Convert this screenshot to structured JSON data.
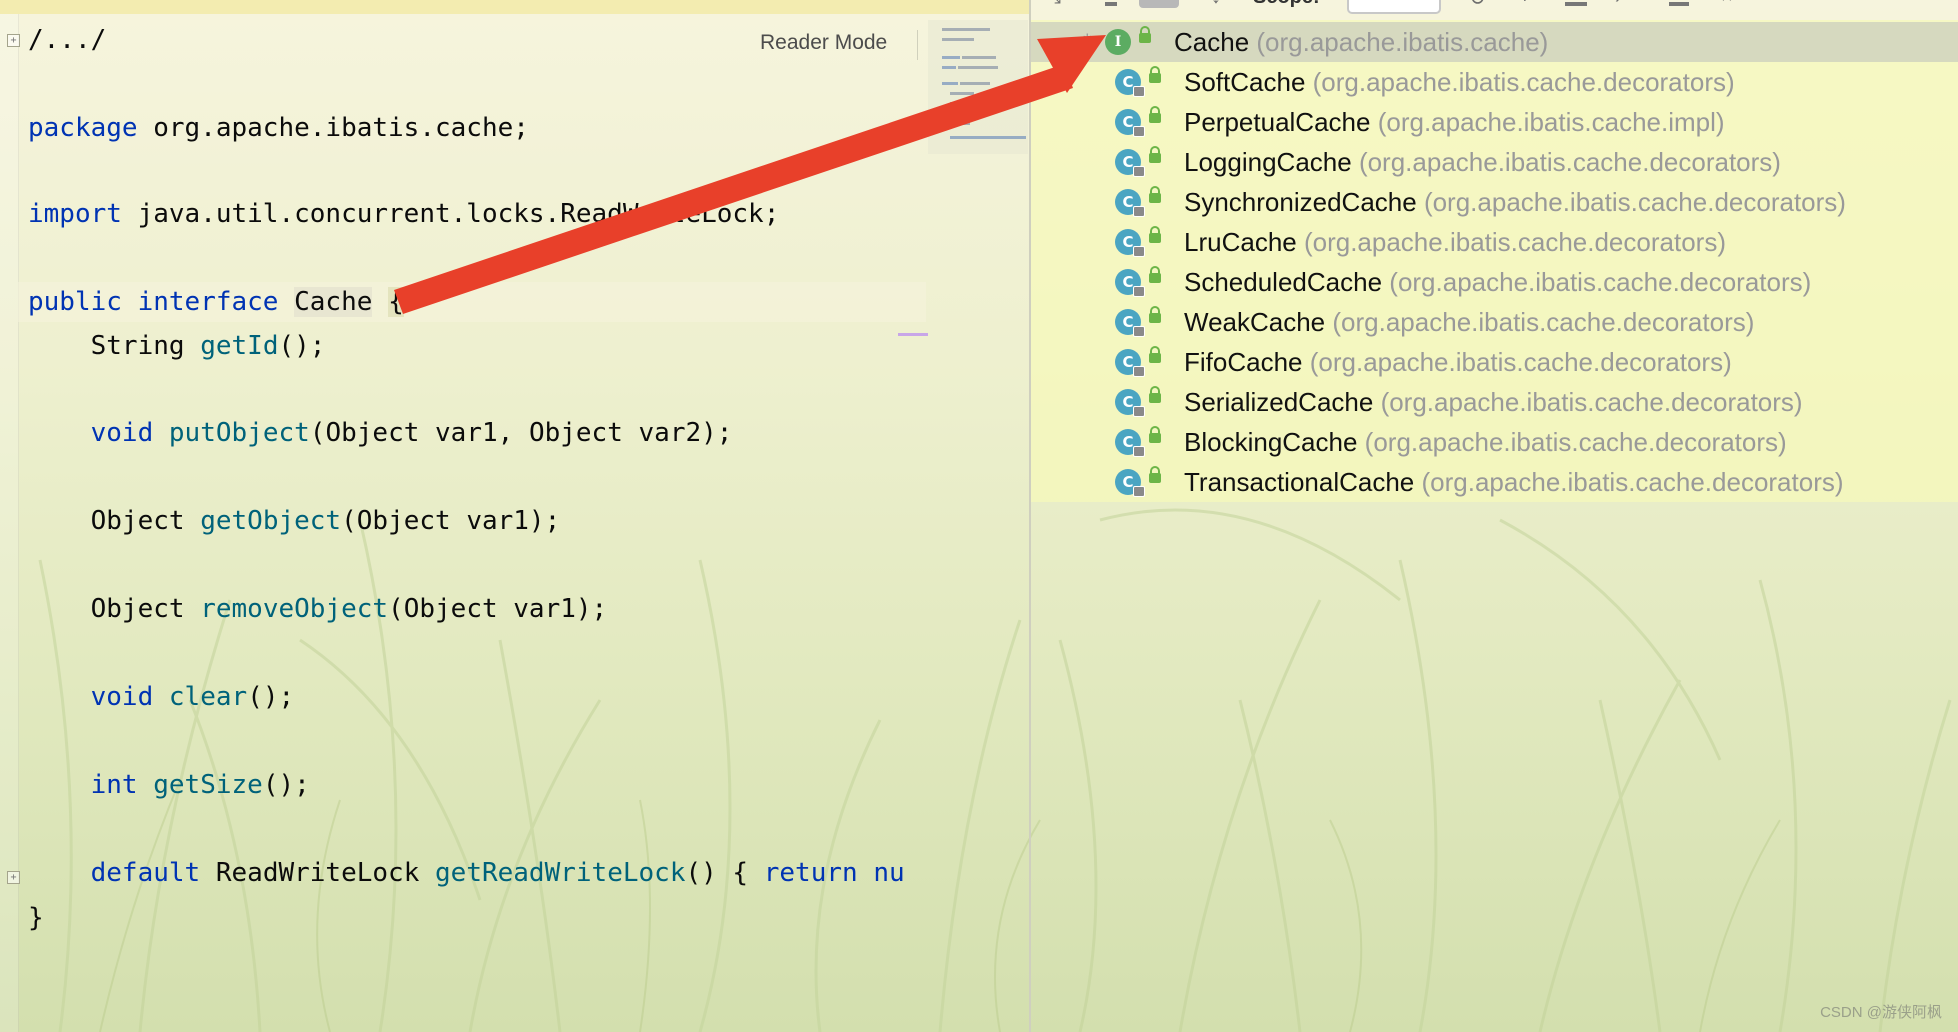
{
  "editor": {
    "reader_mode_label": "Reader Mode",
    "fold_top": "+",
    "fold_bottom": "+",
    "lines": {
      "l1": "/.../",
      "l2": {
        "kw": "package",
        "rest": " org.apache.ibatis.cache;"
      },
      "l3": {
        "kw": "import",
        "rest": " java.util.concurrent.locks.ReadWriteLock;"
      },
      "l4": {
        "kw1": "public",
        "kw2": "interface",
        "name": "Cache",
        "brace": "{"
      },
      "l5": {
        "type": "String",
        "fn": "getId",
        "rest": "();"
      },
      "l6": {
        "kw": "void",
        "fn": "putObject",
        "rest": "(Object var1, Object var2);"
      },
      "l7": {
        "type": "Object",
        "fn": "getObject",
        "rest": "(Object var1);"
      },
      "l8": {
        "type": "Object",
        "fn": "removeObject",
        "rest": "(Object var1);"
      },
      "l9": {
        "kw": "void",
        "fn": "clear",
        "rest": "();"
      },
      "l10": {
        "kw": "int",
        "fn": "getSize",
        "rest": "();"
      },
      "l11": {
        "kw": "default",
        "type": "ReadWriteLock",
        "fn": "getReadWriteLock",
        "rest": "() { ",
        "kw2": "return",
        "tail": " nu"
      },
      "l12": "}"
    }
  },
  "hierarchy": {
    "toolbar": {
      "scope_label": "Scope:"
    },
    "root": {
      "star": "*",
      "icon": "I",
      "name": "Cache",
      "package": "(org.apache.ibatis.cache)"
    },
    "items": [
      {
        "icon": "C",
        "name": "SoftCache",
        "package": "(org.apache.ibatis.cache.decorators)"
      },
      {
        "icon": "C",
        "name": "PerpetualCache",
        "package": "(org.apache.ibatis.cache.impl)"
      },
      {
        "icon": "C",
        "name": "LoggingCache",
        "package": "(org.apache.ibatis.cache.decorators)"
      },
      {
        "icon": "C",
        "name": "SynchronizedCache",
        "package": "(org.apache.ibatis.cache.decorators)"
      },
      {
        "icon": "C",
        "name": "LruCache",
        "package": "(org.apache.ibatis.cache.decorators)"
      },
      {
        "icon": "C",
        "name": "ScheduledCache",
        "package": "(org.apache.ibatis.cache.decorators)"
      },
      {
        "icon": "C",
        "name": "WeakCache",
        "package": "(org.apache.ibatis.cache.decorators)"
      },
      {
        "icon": "C",
        "name": "FifoCache",
        "package": "(org.apache.ibatis.cache.decorators)"
      },
      {
        "icon": "C",
        "name": "SerializedCache",
        "package": "(org.apache.ibatis.cache.decorators)"
      },
      {
        "icon": "C",
        "name": "BlockingCache",
        "package": "(org.apache.ibatis.cache.decorators)"
      },
      {
        "icon": "C",
        "name": "TransactionalCache",
        "package": "(org.apache.ibatis.cache.decorators)"
      }
    ]
  },
  "watermark": "CSDN @游侠阿枫",
  "colors": {
    "arrow": "#e8402a",
    "keyword": "#0033b3",
    "method": "#00627a",
    "class_icon": "#4ba5c2",
    "interface_icon": "#5cac62",
    "package_text": "#999999"
  }
}
